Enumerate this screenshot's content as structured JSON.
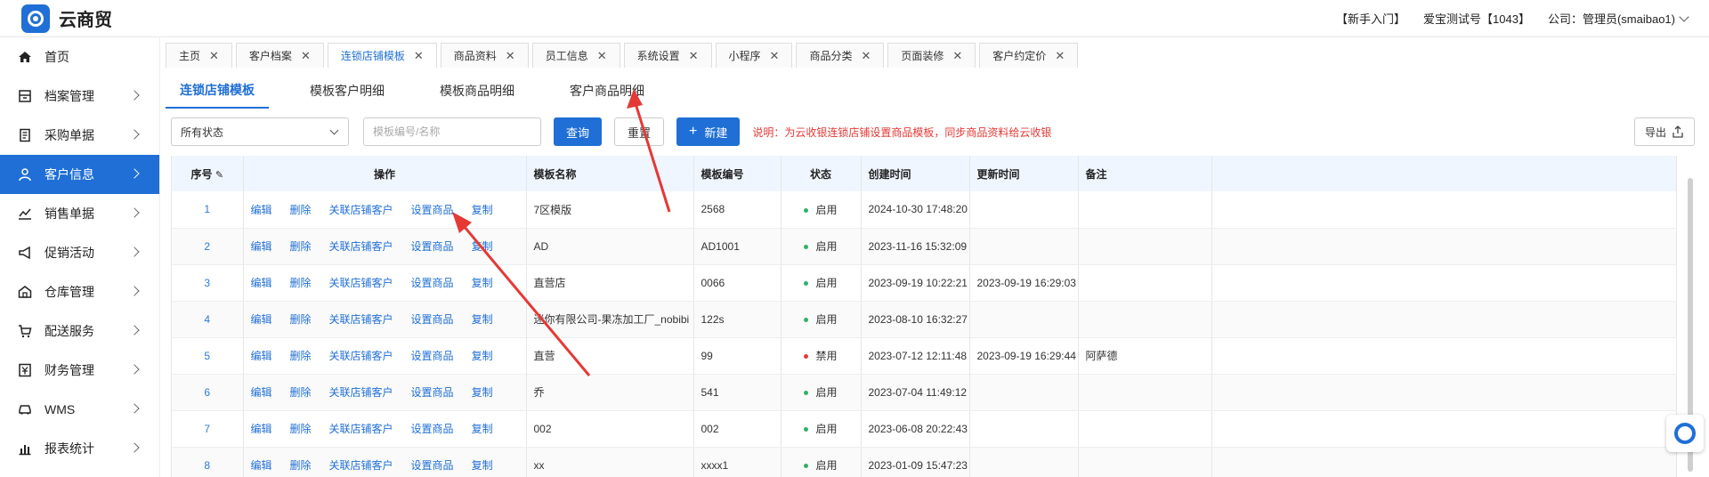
{
  "app": {
    "title": "云商贸",
    "logo_text": "云商"
  },
  "header": {
    "newbie": "【新手入门】",
    "account": "爱宝测试号【1043】",
    "company": "公司：管理员(smaibao1)"
  },
  "sidebar": {
    "items": [
      {
        "label": "首页",
        "icon": "home-icon",
        "active": false
      },
      {
        "label": "档案管理",
        "icon": "archive-icon",
        "active": false
      },
      {
        "label": "采购单据",
        "icon": "document-icon",
        "active": false
      },
      {
        "label": "客户信息",
        "icon": "user-icon",
        "active": true
      },
      {
        "label": "销售单据",
        "icon": "chart-line-icon",
        "active": false
      },
      {
        "label": "促销活动",
        "icon": "megaphone-icon",
        "active": false
      },
      {
        "label": "仓库管理",
        "icon": "warehouse-icon",
        "active": false
      },
      {
        "label": "配送服务",
        "icon": "cart-icon",
        "active": false
      },
      {
        "label": "财务管理",
        "icon": "finance-icon",
        "active": false
      },
      {
        "label": "WMS",
        "icon": "truck-icon",
        "active": false
      },
      {
        "label": "报表统计",
        "icon": "bar-chart-icon",
        "active": false
      }
    ]
  },
  "tabs": [
    {
      "label": "主页",
      "active": false
    },
    {
      "label": "客户档案",
      "active": false
    },
    {
      "label": "连锁店铺模板",
      "active": true
    },
    {
      "label": "商品资料",
      "active": false
    },
    {
      "label": "员工信息",
      "active": false
    },
    {
      "label": "系统设置",
      "active": false
    },
    {
      "label": "小程序",
      "active": false
    },
    {
      "label": "商品分类",
      "active": false
    },
    {
      "label": "页面装修",
      "active": false
    },
    {
      "label": "客户约定价",
      "active": false
    }
  ],
  "subtabs": [
    {
      "label": "连锁店铺模板",
      "active": true
    },
    {
      "label": "模板客户明细",
      "active": false
    },
    {
      "label": "模板商品明细",
      "active": false
    },
    {
      "label": "客户商品明细",
      "active": false
    }
  ],
  "filters": {
    "status_value": "所有状态",
    "search_placeholder": "模板编号/名称",
    "query_label": "查询",
    "reset_label": "重置",
    "new_label": "新建",
    "note": "说明：为云收银连锁店铺设置商品模板，同步商品资料给云收银",
    "export_label": "导出"
  },
  "table": {
    "headers": {
      "seq": "序号",
      "ops": "操作",
      "name": "模板名称",
      "code": "模板编号",
      "status": "状态",
      "created": "创建时间",
      "updated": "更新时间",
      "remark": "备注"
    },
    "ops": {
      "edit": "编辑",
      "delete": "删除",
      "link": "关联店铺客户",
      "set": "设置商品",
      "copy": "复制"
    },
    "rows": [
      {
        "seq": "1",
        "name": "7区模版",
        "code": "2568",
        "status": "启用",
        "status_color": "#2fb26b",
        "created": "2024-10-30 17:48:20",
        "updated": "",
        "remark": ""
      },
      {
        "seq": "2",
        "name": "AD",
        "code": "AD1001",
        "status": "启用",
        "status_color": "#2fb26b",
        "created": "2023-11-16 15:32:09",
        "updated": "",
        "remark": ""
      },
      {
        "seq": "3",
        "name": "直营店",
        "code": "0066",
        "status": "启用",
        "status_color": "#2fb26b",
        "created": "2023-09-19 10:22:21",
        "updated": "2023-09-19 16:29:03",
        "remark": ""
      },
      {
        "seq": "4",
        "name": "迷你有限公司-果冻加工厂_nobibi",
        "code": "122s",
        "status": "启用",
        "status_color": "#2fb26b",
        "created": "2023-08-10 16:32:27",
        "updated": "",
        "remark": ""
      },
      {
        "seq": "5",
        "name": "直营",
        "code": "99",
        "status": "禁用",
        "status_color": "#e53935",
        "created": "2023-07-12 12:11:48",
        "updated": "2023-09-19 16:29:44",
        "remark": "阿萨德"
      },
      {
        "seq": "6",
        "name": "乔",
        "code": "541",
        "status": "启用",
        "status_color": "#2fb26b",
        "created": "2023-07-04 11:49:12",
        "updated": "",
        "remark": ""
      },
      {
        "seq": "7",
        "name": "002",
        "code": "002",
        "status": "启用",
        "status_color": "#2fb26b",
        "created": "2023-06-08 20:22:43",
        "updated": "",
        "remark": ""
      },
      {
        "seq": "8",
        "name": "xx",
        "code": "xxxx1",
        "status": "启用",
        "status_color": "#2fb26b",
        "created": "2023-01-09 15:47:23",
        "updated": "",
        "remark": ""
      }
    ]
  },
  "colors": {
    "accent": "#1f6fd6",
    "annotation": "#e53935"
  }
}
